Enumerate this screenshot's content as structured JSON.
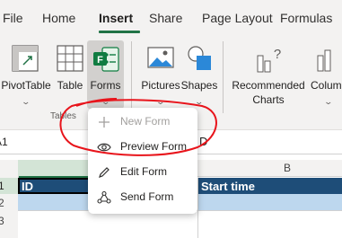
{
  "tabs": [
    {
      "label": "File"
    },
    {
      "label": "Home"
    },
    {
      "label": "Insert"
    },
    {
      "label": "Share"
    },
    {
      "label": "Page Layout"
    },
    {
      "label": "Formulas"
    }
  ],
  "ribbon": {
    "groups": {
      "tables_label": "Tables"
    },
    "buttons": {
      "pivottable": "PivotTable",
      "table": "Table",
      "forms": "Forms",
      "pictures": "Pictures",
      "shapes": "Shapes",
      "recommended_line1": "Recommended",
      "recommended_line2": "Charts",
      "column": "Column"
    }
  },
  "forms_menu": {
    "items": [
      {
        "label": "New Form",
        "icon": "plus-icon",
        "disabled": true
      },
      {
        "label": "Preview Form",
        "icon": "eye-icon",
        "disabled": false
      },
      {
        "label": "Edit Form",
        "icon": "pencil-icon",
        "disabled": false
      },
      {
        "label": "Send Form",
        "icon": "share-icon",
        "disabled": false
      }
    ]
  },
  "formula_bar": {
    "name_box": "A1",
    "fx": "D"
  },
  "grid": {
    "column_headers": [
      "A",
      "B"
    ],
    "row_headers": [
      "1",
      "2",
      "3"
    ],
    "cells": {
      "A1": "ID",
      "B1": "Start time"
    }
  },
  "colors": {
    "accent": "#217346",
    "header_row": "#1e4d78",
    "banded_row": "#bdd7ee",
    "annotation": "#e8141b"
  }
}
